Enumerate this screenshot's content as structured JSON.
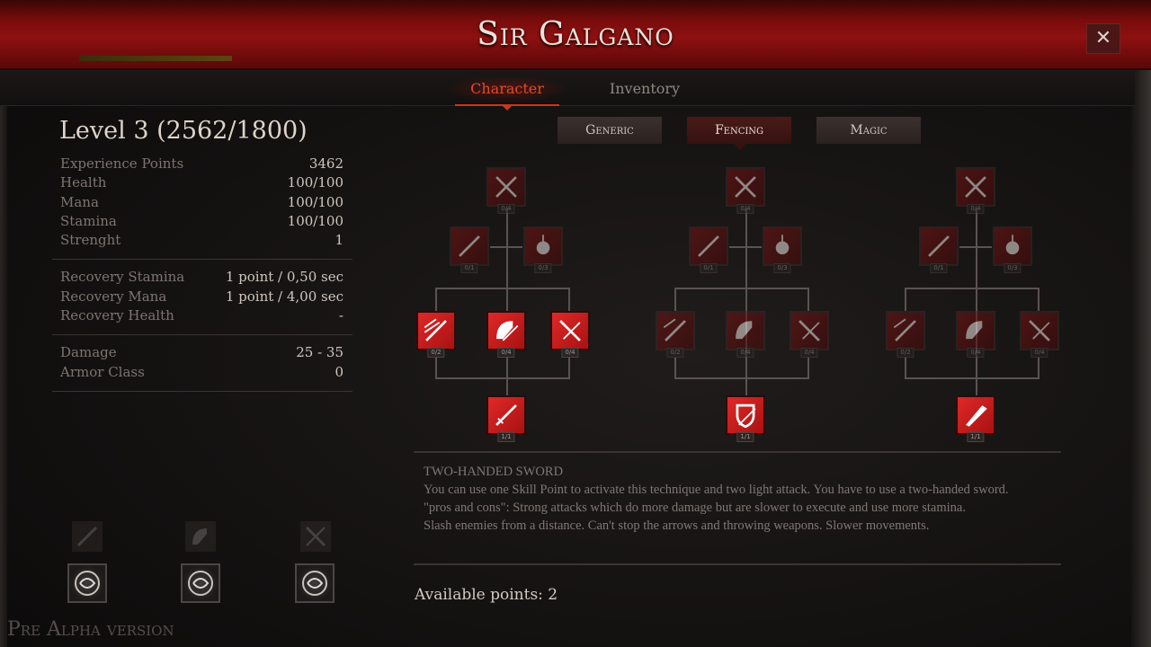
{
  "window": {
    "title": "Sir Galgano",
    "close_label": "✕"
  },
  "tabs": [
    {
      "label": "Character",
      "active": true
    },
    {
      "label": "Inventory",
      "active": false
    }
  ],
  "character": {
    "level_text": "Level 3 (2562/1800)",
    "stats_group1": [
      {
        "label": "Experience Points",
        "value": "3462"
      },
      {
        "label": "Health",
        "value": "100/100"
      },
      {
        "label": "Mana",
        "value": "100/100"
      },
      {
        "label": "Stamina",
        "value": "100/100"
      },
      {
        "label": "Strenght",
        "value": "1"
      }
    ],
    "stats_group2": [
      {
        "label": "Recovery Stamina",
        "value": "1 point / 0,50 sec"
      },
      {
        "label": "Recovery Mana",
        "value": "1 point / 4,00 sec"
      },
      {
        "label": "Recovery Health",
        "value": "-"
      }
    ],
    "stats_group3": [
      {
        "label": "Damage",
        "value": "25 - 35"
      },
      {
        "label": "Armor Class",
        "value": "0"
      }
    ]
  },
  "categories": [
    {
      "label": "Generic",
      "active": false
    },
    {
      "label": "Fencing",
      "active": true
    },
    {
      "label": "Magic",
      "active": false
    }
  ],
  "skill_nodes": {
    "top": "0/4",
    "left_mid": "0/1",
    "right_mid": "0/3",
    "row": [
      "0/2",
      "0/4",
      "0/4"
    ],
    "bottom": "1/1"
  },
  "description": {
    "title": "TWO-HANDED SWORD",
    "line1": "You can use one Skill Point to activate this technique and two light attack. You have to use a two-handed sword.",
    "line2": "\"pros and cons\": Strong attacks which do more damage but are slower to execute and use more stamina.",
    "line3": "Slash enemies from a distance. Can't stop the arrows and throwing weapons. Slower movements."
  },
  "available_points": "Available points: 2",
  "footer_text": "Pre Alpha version",
  "colors": {
    "accent": "#c23a1e",
    "active_skill": "#e02828",
    "header_red": "#8e1010"
  }
}
